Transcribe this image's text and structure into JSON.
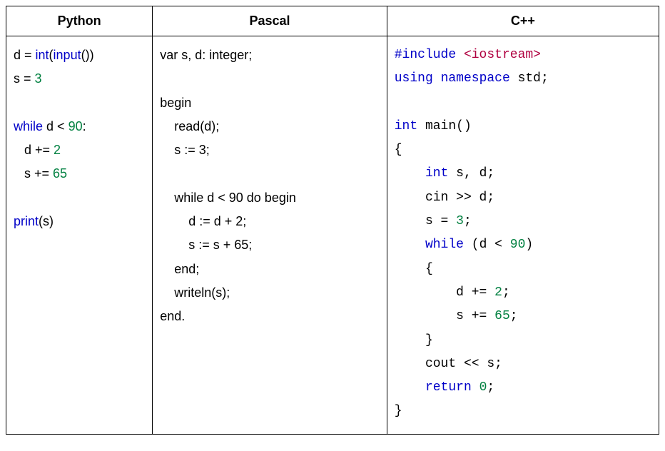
{
  "headers": {
    "python": "Python",
    "pascal": "Pascal",
    "cpp": "C++"
  },
  "python": {
    "l1_a": "d = ",
    "l1_b": "int",
    "l1_c": "(",
    "l1_d": "input",
    "l1_e": "())",
    "l2_a": "s = ",
    "l2_b": "3",
    "l3": "",
    "l4_a": "while",
    "l4_b": " d < ",
    "l4_c": "90",
    "l4_d": ":",
    "l5_a": "   d += ",
    "l5_b": "2",
    "l6_a": "   s += ",
    "l6_b": "65",
    "l7": "",
    "l8_a": "print",
    "l8_b": "(s)"
  },
  "pascal": {
    "l1": "var s, d: integer;",
    "l2": "",
    "l3": "begin",
    "l4": "    read(d);",
    "l5": "    s := 3;",
    "l6": "",
    "l7": "    while d < 90 do begin",
    "l8": "        d := d + 2;",
    "l9": "        s := s + 65;",
    "l10": "    end;",
    "l11": "    writeln(s);",
    "l12": "end."
  },
  "cpp": {
    "l1_a": "#include ",
    "l1_b": "<iostream>",
    "l2_a": "using",
    "l2_b": " ",
    "l2_c": "namespace",
    "l2_d": " std;",
    "l3": "",
    "l4_a": "int",
    "l4_b": " main()",
    "l5": "{",
    "l6_a": "    ",
    "l6_b": "int",
    "l6_c": " s, d;",
    "l7": "    cin >> d;",
    "l8_a": "    s = ",
    "l8_b": "3",
    "l8_c": ";",
    "l9_a": "    ",
    "l9_b": "while",
    "l9_c": " (d < ",
    "l9_d": "90",
    "l9_e": ")",
    "l10": "    {",
    "l11_a": "        d += ",
    "l11_b": "2",
    "l11_c": ";",
    "l12_a": "        s += ",
    "l12_b": "65",
    "l12_c": ";",
    "l13": "    }",
    "l14": "    cout << s;",
    "l15_a": "    ",
    "l15_b": "return",
    "l15_c": " ",
    "l15_d": "0",
    "l15_e": ";",
    "l16": "}"
  }
}
